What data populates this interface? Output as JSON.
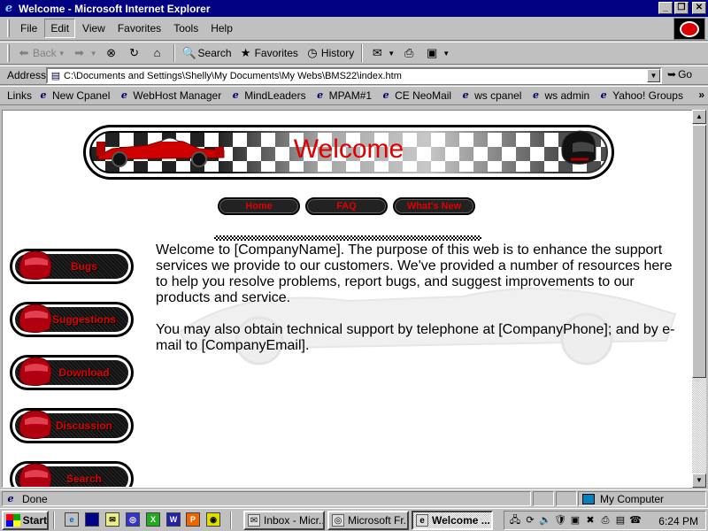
{
  "window": {
    "title": "Welcome - Microsoft Internet Explorer",
    "minimize": "_",
    "maximize": "❐",
    "close": "✕"
  },
  "menubar": {
    "items": [
      "File",
      "Edit",
      "View",
      "Favorites",
      "Tools",
      "Help"
    ]
  },
  "toolbar": {
    "back": "Back",
    "search": "Search",
    "favorites": "Favorites",
    "history": "History"
  },
  "address": {
    "label": "Address",
    "value": "C:\\Documents and Settings\\Shelly\\My Documents\\My Webs\\BMS22\\index.htm",
    "go": "Go"
  },
  "links": {
    "label": "Links",
    "items": [
      "New Cpanel",
      "WebHost Manager",
      "MindLeaders",
      "MPAM#1",
      "CE NeoMail",
      "ws cpanel",
      "ws admin",
      "Yahoo! Groups"
    ],
    "more": "»"
  },
  "page": {
    "banner_title": "Welcome",
    "topnav": [
      "Home",
      "FAQ",
      "What's New"
    ],
    "sidenav": [
      "Bugs",
      "Suggestions",
      "Download",
      "Discussion",
      "Search"
    ],
    "paragraphs": [
      "Welcome to [CompanyName]. The purpose of this web is to enhance the support services we provide to our customers. We've provided a number of resources here to help you resolve problems, report bugs, and suggest improvements to our products and service.",
      "You may also obtain technical support by telephone at [CompanyPhone]; and by e-mail to [CompanyEmail]."
    ]
  },
  "status": {
    "text": "Done",
    "zone": "My Computer"
  },
  "taskbar": {
    "start": "Start",
    "tasks": [
      "Inbox - Micr...",
      "Microsoft Fr...",
      "Welcome ..."
    ],
    "clock": "6:24 PM"
  },
  "colors": {
    "titlebar": "#000080",
    "accent_red": "#e00000",
    "chrome": "#c0c0c0"
  }
}
